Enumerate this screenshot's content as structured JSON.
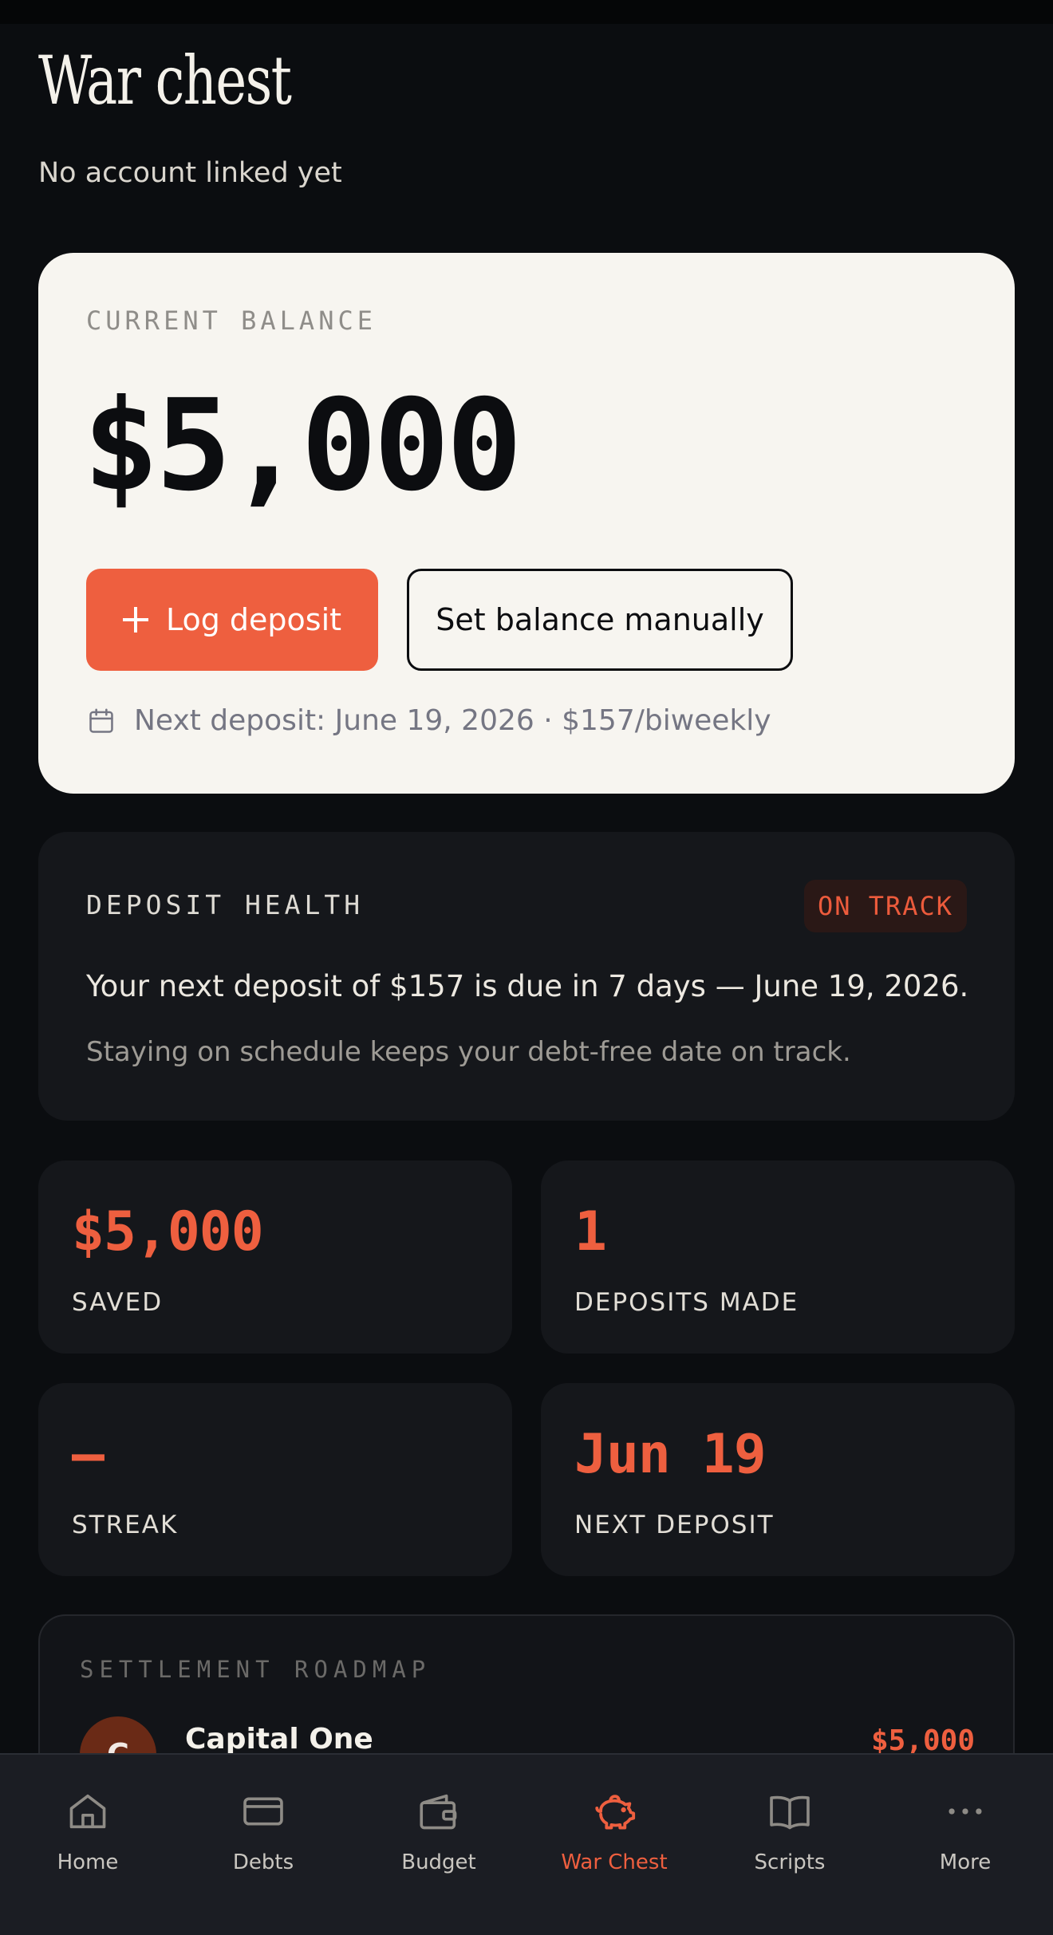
{
  "header": {
    "title": "War chest",
    "subtitle": "No account linked yet"
  },
  "balance": {
    "label": "CURRENT BALANCE",
    "amount": "$5,000",
    "log_deposit_label": "Log deposit",
    "set_manual_label": "Set balance manually",
    "next_deposit_text": "Next deposit: June 19, 2026 · $157/biweekly"
  },
  "health": {
    "label": "DEPOSIT HEALTH",
    "badge": "ON TRACK",
    "message": "Your next deposit of $157 is due in 7 days — June 19, 2026.",
    "submessage": "Staying on schedule keeps your debt-free date on track."
  },
  "stats": [
    {
      "value": "$5,000",
      "label": "SAVED"
    },
    {
      "value": "1",
      "label": "DEPOSITS MADE"
    },
    {
      "value": "—",
      "label": "STREAK"
    },
    {
      "value": "Jun 19",
      "label": "NEXT DEPOSIT"
    }
  ],
  "roadmap": {
    "label": "SETTLEMENT ROADMAP",
    "items": [
      {
        "initial": "C",
        "name": "Capital One",
        "amount": "$5,000"
      }
    ]
  },
  "nav": {
    "items": [
      {
        "label": "Home",
        "icon": "home-icon"
      },
      {
        "label": "Debts",
        "icon": "card-icon"
      },
      {
        "label": "Budget",
        "icon": "wallet-icon"
      },
      {
        "label": "War Chest",
        "icon": "piggy-bank-icon"
      },
      {
        "label": "Scripts",
        "icon": "book-icon"
      },
      {
        "label": "More",
        "icon": "more-icon"
      }
    ],
    "active_index": 3
  },
  "colors": {
    "accent": "#ee5f3f",
    "background": "#0b0d10",
    "card_light": "#f7f5f0",
    "card_dark": "#15171b"
  }
}
